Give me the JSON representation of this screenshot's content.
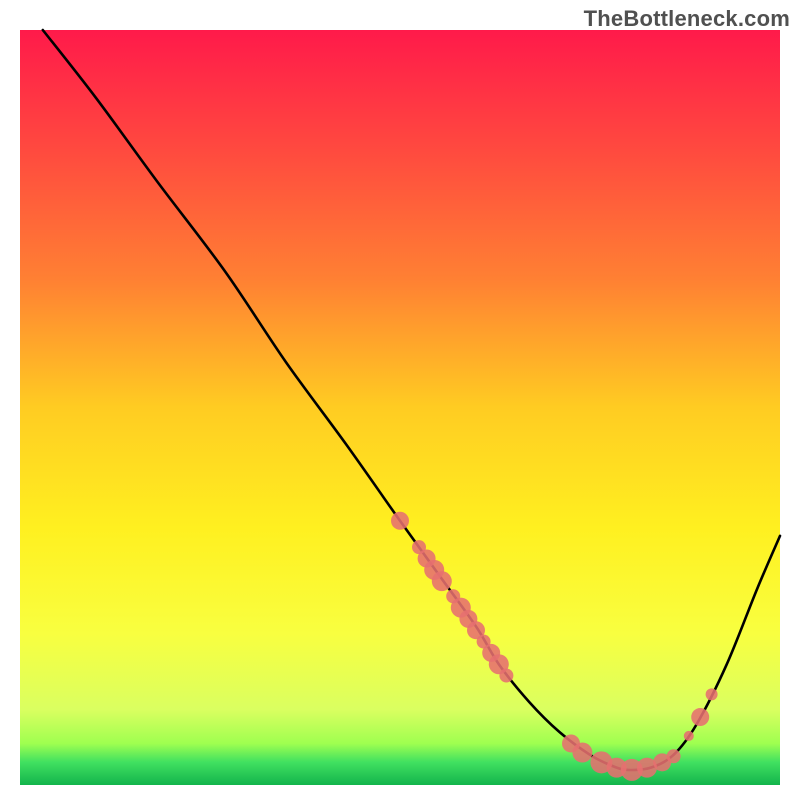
{
  "watermark": "TheBottleneck.com",
  "chart_data": {
    "type": "line",
    "title": "",
    "xlabel": "",
    "ylabel": "",
    "xlim": [
      0,
      100
    ],
    "ylim": [
      0,
      100
    ],
    "grid": false,
    "gradient_stops": [
      {
        "offset": 0.0,
        "color": "#ff1a4a"
      },
      {
        "offset": 0.16,
        "color": "#ff4a3f"
      },
      {
        "offset": 0.33,
        "color": "#ff8033"
      },
      {
        "offset": 0.5,
        "color": "#ffcc22"
      },
      {
        "offset": 0.66,
        "color": "#fff020"
      },
      {
        "offset": 0.8,
        "color": "#f8ff40"
      },
      {
        "offset": 0.9,
        "color": "#daff60"
      },
      {
        "offset": 0.945,
        "color": "#9fff50"
      },
      {
        "offset": 0.97,
        "color": "#40e060"
      },
      {
        "offset": 1.0,
        "color": "#13b44c"
      }
    ],
    "series": [
      {
        "name": "bottleneck-curve",
        "x": [
          3,
          10,
          18,
          27,
          35,
          43,
          50,
          55,
          60,
          63,
          67,
          71,
          75,
          78,
          80,
          83,
          86,
          89,
          93,
          97,
          100
        ],
        "values": [
          100,
          91,
          80,
          68,
          56,
          45,
          35,
          28,
          21,
          16,
          11,
          7,
          4,
          2.5,
          2,
          2.3,
          4,
          8,
          16,
          26,
          33
        ]
      }
    ],
    "scatter_points": {
      "name": "highlighted-points",
      "color": "#e67070",
      "items": [
        {
          "x": 50.0,
          "y": 35.0,
          "r": 9
        },
        {
          "x": 52.5,
          "y": 31.5,
          "r": 7
        },
        {
          "x": 53.5,
          "y": 30.0,
          "r": 9
        },
        {
          "x": 54.5,
          "y": 28.5,
          "r": 10
        },
        {
          "x": 55.5,
          "y": 27.0,
          "r": 10
        },
        {
          "x": 57.0,
          "y": 25.0,
          "r": 7
        },
        {
          "x": 58.0,
          "y": 23.5,
          "r": 10
        },
        {
          "x": 59.0,
          "y": 22.0,
          "r": 9
        },
        {
          "x": 60.0,
          "y": 20.5,
          "r": 9
        },
        {
          "x": 61.0,
          "y": 19.0,
          "r": 7
        },
        {
          "x": 62.0,
          "y": 17.5,
          "r": 9
        },
        {
          "x": 63.0,
          "y": 16.0,
          "r": 10
        },
        {
          "x": 64.0,
          "y": 14.5,
          "r": 7
        },
        {
          "x": 72.5,
          "y": 5.5,
          "r": 9
        },
        {
          "x": 74.0,
          "y": 4.3,
          "r": 10
        },
        {
          "x": 76.5,
          "y": 3.0,
          "r": 11
        },
        {
          "x": 78.5,
          "y": 2.3,
          "r": 10
        },
        {
          "x": 80.5,
          "y": 2.0,
          "r": 11
        },
        {
          "x": 82.5,
          "y": 2.3,
          "r": 10
        },
        {
          "x": 84.5,
          "y": 3.0,
          "r": 9
        },
        {
          "x": 86.0,
          "y": 3.8,
          "r": 7
        },
        {
          "x": 88.0,
          "y": 6.5,
          "r": 5
        },
        {
          "x": 89.5,
          "y": 9.0,
          "r": 9
        },
        {
          "x": 91.0,
          "y": 12.0,
          "r": 6
        }
      ]
    }
  }
}
